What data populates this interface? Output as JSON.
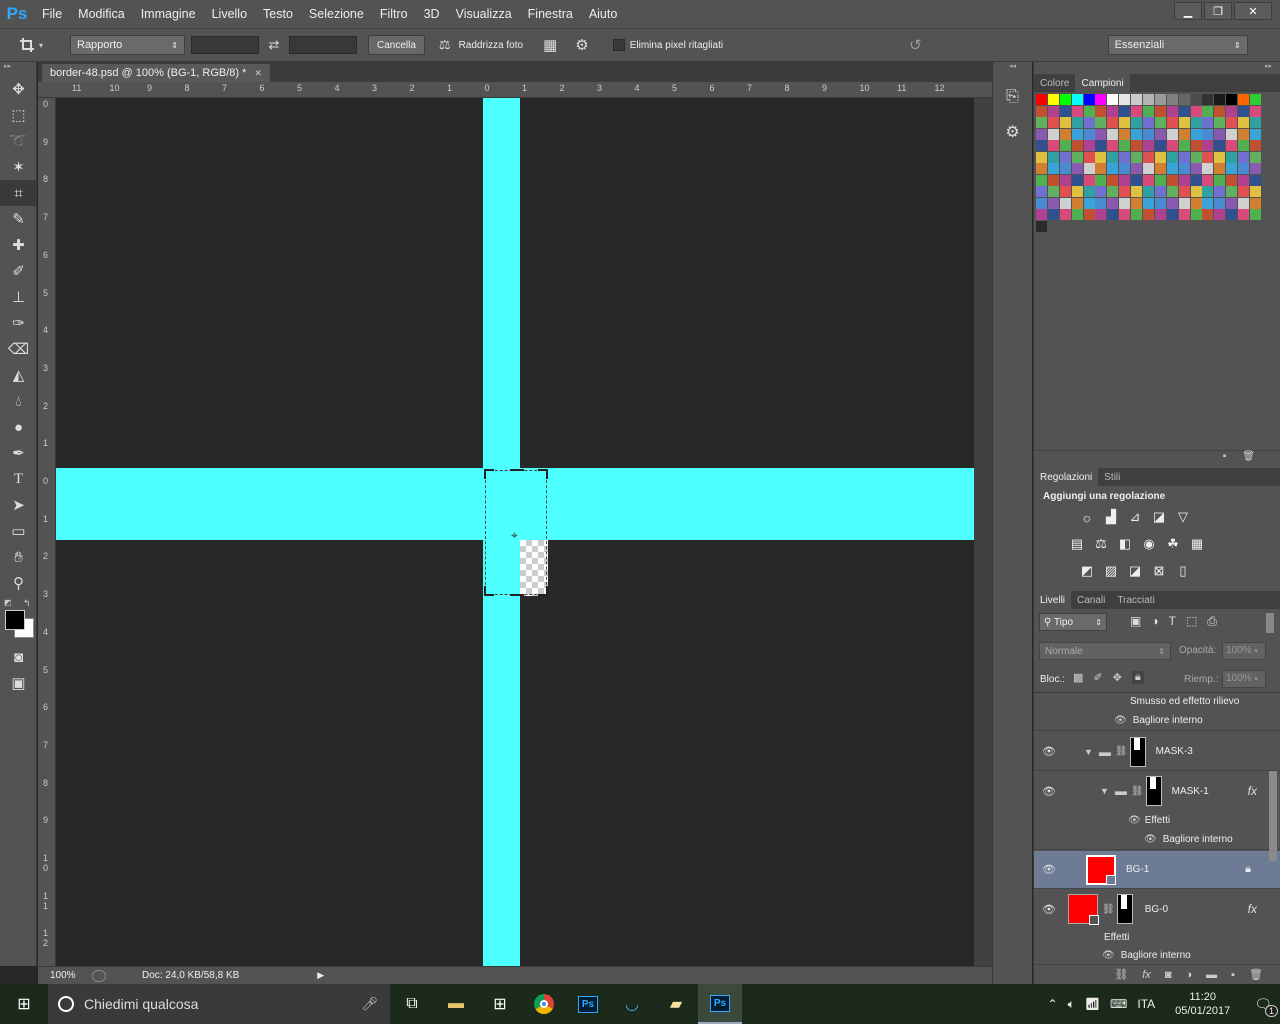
{
  "app": {
    "logo": "Ps"
  },
  "menu": [
    "File",
    "Modifica",
    "Immagine",
    "Livello",
    "Testo",
    "Selezione",
    "Filtro",
    "3D",
    "Visualizza",
    "Finestra",
    "Aiuto"
  ],
  "window_controls": {
    "minimize": "▁",
    "restore": "❐",
    "close": "✕"
  },
  "options": {
    "ratio_select": "Rapporto",
    "cancel": "Cancella",
    "straighten": "Raddrizza foto",
    "delete_cropped": "Elimina pixel ritagliati",
    "workspace": "Essenziali"
  },
  "document": {
    "tab_title": "border-48.psd @ 100% (BG-1, RGB/8) *"
  },
  "rulers": {
    "horizontal": [
      "11",
      "10",
      "9",
      "8",
      "7",
      "6",
      "5",
      "4",
      "3",
      "2",
      "1",
      "0",
      "1",
      "2",
      "3",
      "4",
      "5",
      "6",
      "7",
      "8",
      "9",
      "10",
      "11",
      "12"
    ],
    "vertical": [
      "0",
      "9",
      "8",
      "7",
      "6",
      "5",
      "4",
      "3",
      "2",
      "1",
      "0",
      "1",
      "2",
      "3",
      "4",
      "5",
      "6",
      "7",
      "8",
      "9",
      "1 0",
      "1 1",
      "1 2",
      "1 3"
    ]
  },
  "canvas": {
    "accent": "#4dffff",
    "background": "#282828"
  },
  "status": {
    "zoom": "100%",
    "doc": "Doc: 24,0 KB/58,8 KB"
  },
  "panels": {
    "swatch_tabs": [
      "Colore",
      "Campioni"
    ],
    "adjust_tabs": [
      "Regolazioni",
      "Stili"
    ],
    "adjust_title": "Aggiungi una regolazione",
    "layer_tabs": [
      "Livelli",
      "Canali",
      "Tracciati"
    ],
    "filter_kind": "Tipo",
    "blend_mode": "Normale",
    "opacity_label": "Opacità:",
    "opacity_value": "100%",
    "lock_label": "Bloc.:",
    "fill_label": "Riemp.:",
    "fill_value": "100%"
  },
  "layers": {
    "effect1": "Smusso ed effetto rilievo",
    "effect2": "Bagliore interno",
    "mask3": "MASK-3",
    "mask1": "MASK-1",
    "effects": "Effetti",
    "mask1_glow": "Bagliore interno",
    "bg1": "BG-1",
    "bg0": "BG-0",
    "bg0_effects": "Effetti",
    "bg0_glow": "Bagliore interno"
  },
  "taskbar": {
    "search": "Chiedimi qualcosa",
    "lang": "ITA",
    "time": "11:20",
    "date": "05/01/2017",
    "notif": "1"
  }
}
